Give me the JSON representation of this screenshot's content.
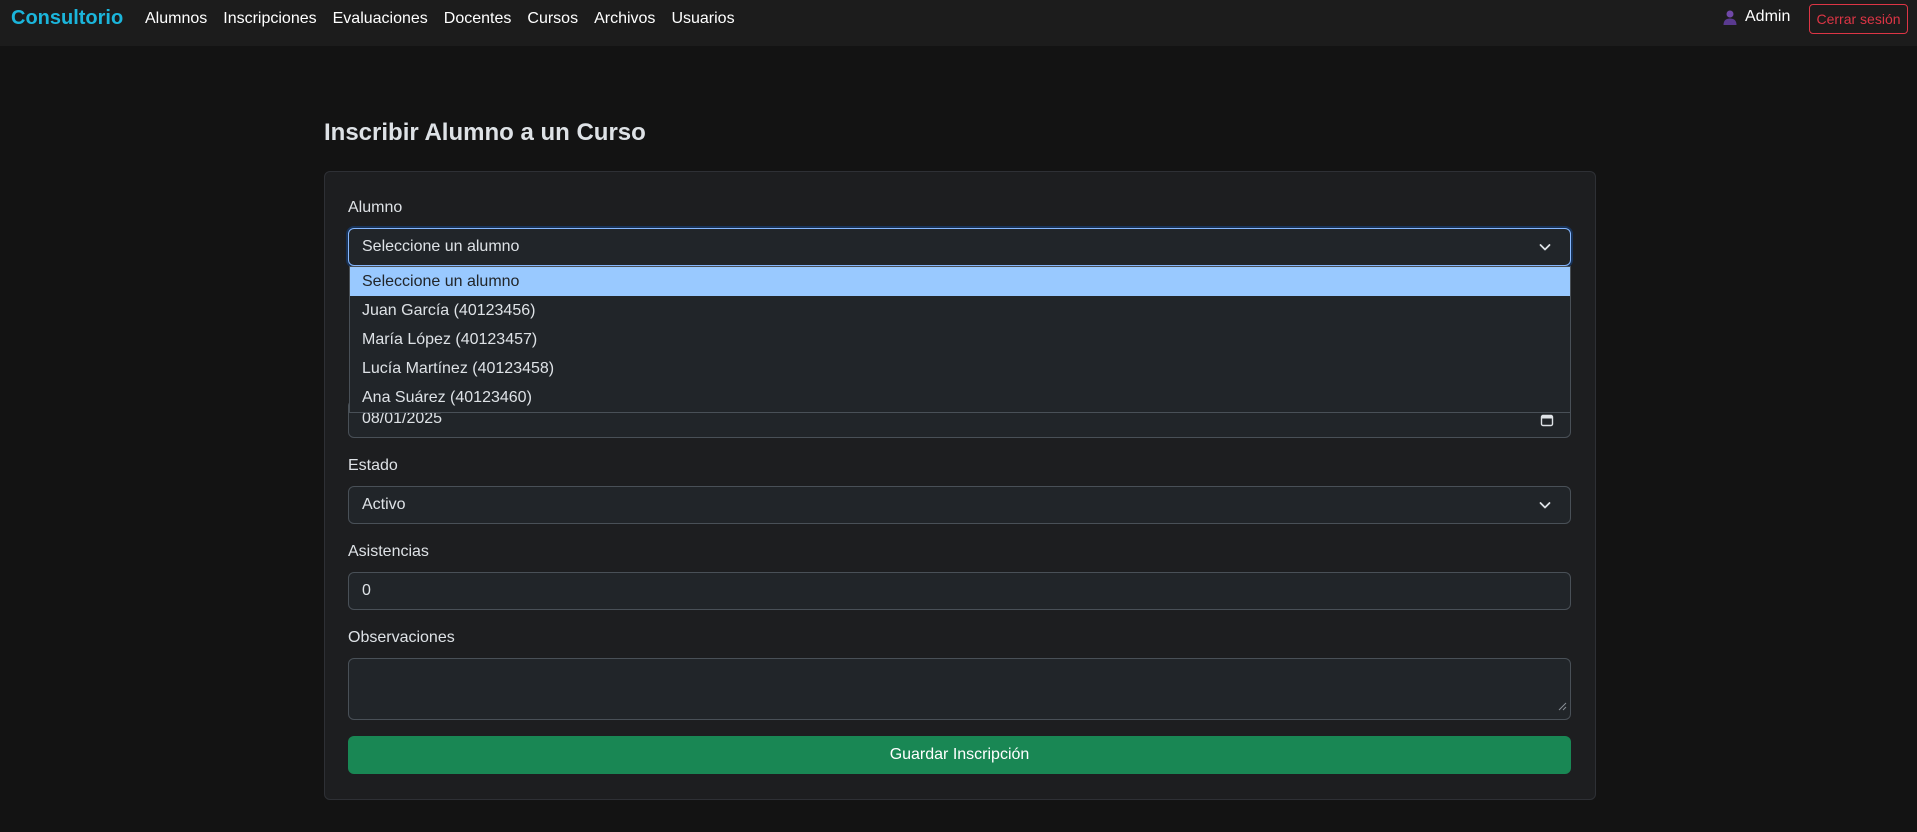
{
  "navbar": {
    "brand": "Consultorio",
    "links": [
      "Alumnos",
      "Inscripciones",
      "Evaluaciones",
      "Docentes",
      "Cursos",
      "Archivos",
      "Usuarios"
    ],
    "user_name": "Admin",
    "user_icon": "user-icon",
    "logout_label": "Cerrar sesión",
    "brand_color": "#1bb5db",
    "logout_color": "#dc3545"
  },
  "page": {
    "title": "Inscribir Alumno a un Curso"
  },
  "form": {
    "alumno": {
      "label": "Alumno",
      "value": "Seleccione un alumno",
      "options": [
        "Seleccione un alumno",
        "Juan García (40123456)",
        "María López (40123457)",
        "Lucía Martínez (40123458)",
        "Ana Suárez (40123460)"
      ]
    },
    "fecha": {
      "value": "08/01/2025",
      "icon": "calendar-icon"
    },
    "estado": {
      "label": "Estado",
      "value": "Activo"
    },
    "asistencias": {
      "label": "Asistencias",
      "value": "0"
    },
    "observaciones": {
      "label": "Observaciones",
      "value": ""
    },
    "submit_label": "Guardar Inscripción",
    "submit_color": "#198754"
  }
}
